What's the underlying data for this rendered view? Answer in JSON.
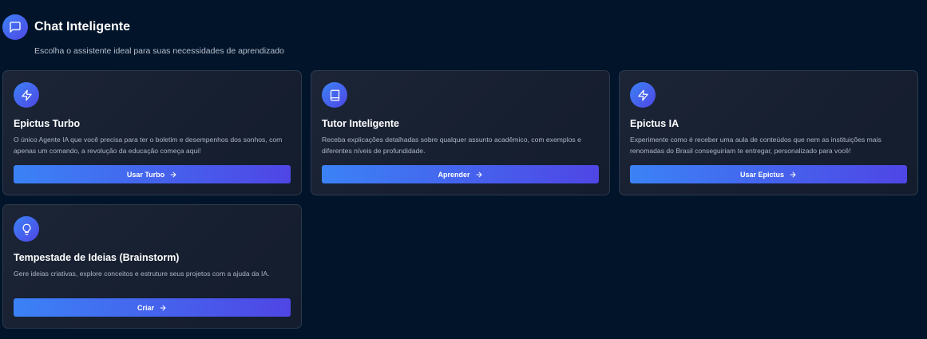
{
  "header": {
    "title": "Chat Inteligente",
    "subtitle": "Escolha o assistente ideal para suas necessidades de aprendizado",
    "icon": "chat-bubble-icon"
  },
  "cards": [
    {
      "icon": "lightning-icon",
      "title": "Epictus Turbo",
      "description": "O único Agente IA que você precisa para ter o boletim e desempenhos dos sonhos, com apenas um comando, a revolução da educação começa aqui!",
      "button_label": "Usar Turbo"
    },
    {
      "icon": "book-icon",
      "title": "Tutor Inteligente",
      "description": "Receba explicações detalhadas sobre qualquer assunto acadêmico, com exemplos e diferentes níveis de profundidade.",
      "button_label": "Aprender"
    },
    {
      "icon": "lightning-icon",
      "title": "Epictus IA",
      "description": "Experimente como é receber uma aula de conteúdos que nem as instituições mais renomadas do Brasil conseguiriam te entregar, personalizado para você!",
      "button_label": "Usar Epictus"
    },
    {
      "icon": "lightbulb-icon",
      "title": "Tempestade de Ideias (Brainstorm)",
      "description": "Gere ideias criativas, explore conceitos e estruture seus projetos com a ajuda da IA.",
      "button_label": "Criar"
    }
  ],
  "colors": {
    "background": "#02142a",
    "card_background": "#1a2334",
    "card_border": "#2c3a4f",
    "accent_start": "#3b82f6",
    "accent_end": "#4f46e5",
    "text_primary": "#ffffff",
    "text_secondary": "#aeb6c3"
  }
}
